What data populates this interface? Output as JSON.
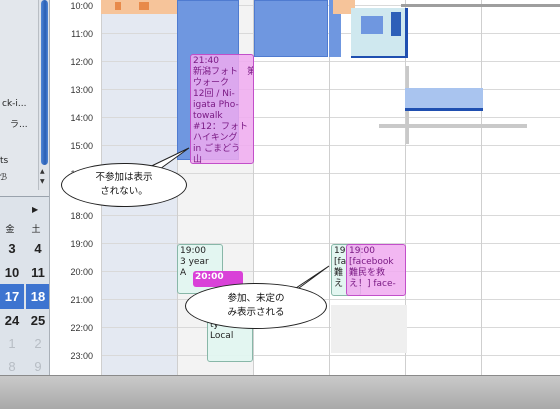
{
  "sidebar": {
    "items": [
      "ck-i...",
      "ラ...",
      "ts",
      "ℬ"
    ],
    "scroll_up": "▲",
    "scroll_down": "▼"
  },
  "mini_calendar": {
    "nav_next": "▶",
    "weekdays": [
      "金",
      "土"
    ],
    "rows": [
      [
        "3",
        "4"
      ],
      [
        "10",
        "11"
      ],
      [
        "17",
        "18"
      ],
      [
        "24",
        "25"
      ],
      [
        "1",
        "2"
      ],
      [
        "8",
        "9"
      ]
    ]
  },
  "grid": {
    "times": [
      "10:00",
      "11:00",
      "12:00",
      "13:00",
      "14:00",
      "15:00",
      "16:00",
      "18:00",
      "19:00",
      "20:00",
      "21:00",
      "22:00",
      "23:00"
    ]
  },
  "events": {
    "photowalk": "21:40\n新潟フォト　第\nウォーク\n12回 / Ni-\nigata Pho-\ntowalk\n#12：フォト\nハイキング\nin ごまどう\n山",
    "year_event_top": "19:00\n3 year\nA",
    "year_event_tail": "ty — The\nLocal",
    "pink_bar": "20:00",
    "fb_back": "19\n[fa\n難\nえ",
    "fb_front": "19:00\n[facebook\n難民を救\nえ！] face-"
  },
  "callouts": {
    "hidden": "不参加は表示\nされない。",
    "shown": "参加、未定の\nみ表示される"
  },
  "colors": {
    "accent": "#3d74d0",
    "event_pink": "#f0aaf0",
    "event_blue": "#6f97e0"
  }
}
